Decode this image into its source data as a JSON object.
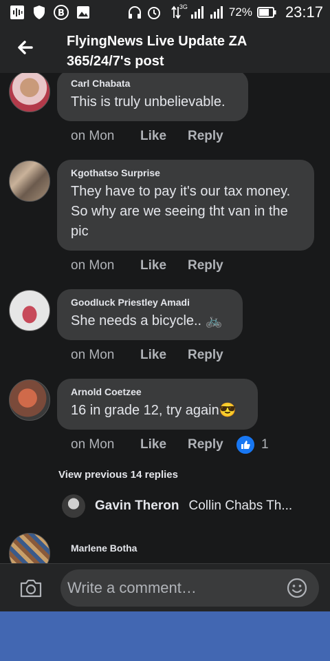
{
  "status_bar": {
    "battery_percent": "72%",
    "time": "23:17",
    "network_label": "3G",
    "icons": [
      "soundwave-icon",
      "shield-icon",
      "bitcoin-icon",
      "image-icon",
      "headphones-icon",
      "alarm-icon",
      "data-arrows-icon",
      "signal-icon",
      "signal-icon",
      "battery-icon"
    ]
  },
  "header": {
    "title_line1": "FlyingNews Live Update ZA",
    "title_line2": "365/24/7's post",
    "back_icon": "back-arrow-icon"
  },
  "comments": [
    {
      "author": "Carl Chabata",
      "text_lines": [
        "This is truly unbelievable."
      ],
      "time": "on Mon",
      "like": "Like",
      "reply": "Reply"
    },
    {
      "author": "Kgothatso Surprise",
      "text_lines": [
        "They have to pay it's our tax money.",
        "So why are we seeing tht van in the",
        "pic"
      ],
      "time": "on Mon",
      "like": "Like",
      "reply": "Reply"
    },
    {
      "author": "Goodluck Priestley Amadi",
      "text_lines": [
        "She needs a bicycle.. 🚲"
      ],
      "time": "on Mon",
      "like": "Like",
      "reply": "Reply"
    },
    {
      "author": "Arnold Coetzee",
      "text_lines": [
        "16 in grade 12, try again😎"
      ],
      "time": "on Mon",
      "like": "Like",
      "reply": "Reply",
      "reaction_count": "1"
    }
  ],
  "view_previous": "View previous 14 replies",
  "latest_reply": {
    "author": "Gavin Theron",
    "text": "Collin Chabs Th..."
  },
  "next_comment_author": "Marlene Botha",
  "composer": {
    "placeholder": "Write a comment…"
  },
  "colors": {
    "background": "#18191a",
    "bubble": "#3a3b3c",
    "bars": "#242526",
    "nav": "#4267b2",
    "like_blue": "#1877f2"
  }
}
